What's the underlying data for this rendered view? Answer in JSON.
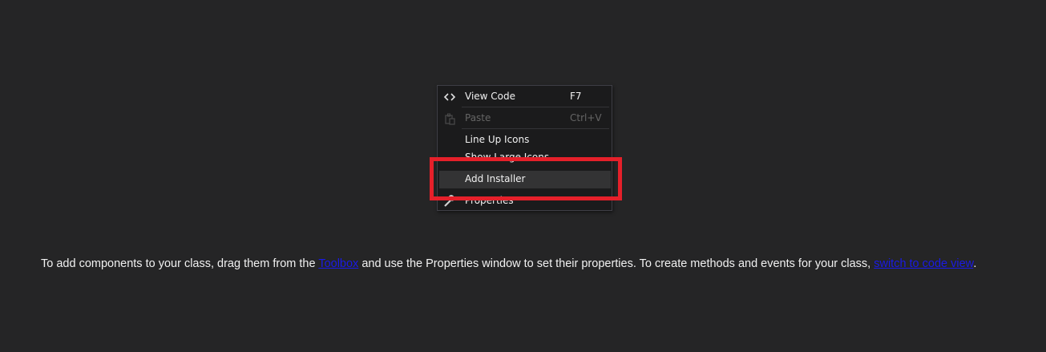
{
  "menu": {
    "items": [
      {
        "label": "View Code",
        "shortcut": "F7",
        "icon": "code-brackets-icon",
        "enabled": true
      },
      {
        "label": "Paste",
        "shortcut": "Ctrl+V",
        "icon": "paste-icon",
        "enabled": false
      },
      {
        "label": "Line Up Icons",
        "shortcut": "",
        "icon": "",
        "enabled": true
      },
      {
        "label": "Show Large Icons",
        "shortcut": "",
        "icon": "",
        "enabled": true
      },
      {
        "label": "Add Installer",
        "shortcut": "",
        "icon": "",
        "enabled": true,
        "highlighted": true
      },
      {
        "label": "Properties",
        "shortcut": "",
        "icon": "wrench-icon",
        "enabled": true
      }
    ]
  },
  "hint": {
    "text_before": "To add components to your class, drag them from the ",
    "toolbox_link": "Toolbox",
    "text_middle": " and use the Properties window to set their properties. To create methods and events for your class, ",
    "code_view_link": "switch to code view",
    "text_after": "."
  },
  "colors": {
    "background": "#252526",
    "menu_background": "#1b1b1c",
    "highlight_box": "#e5202a",
    "link": "#1a1ae6"
  }
}
